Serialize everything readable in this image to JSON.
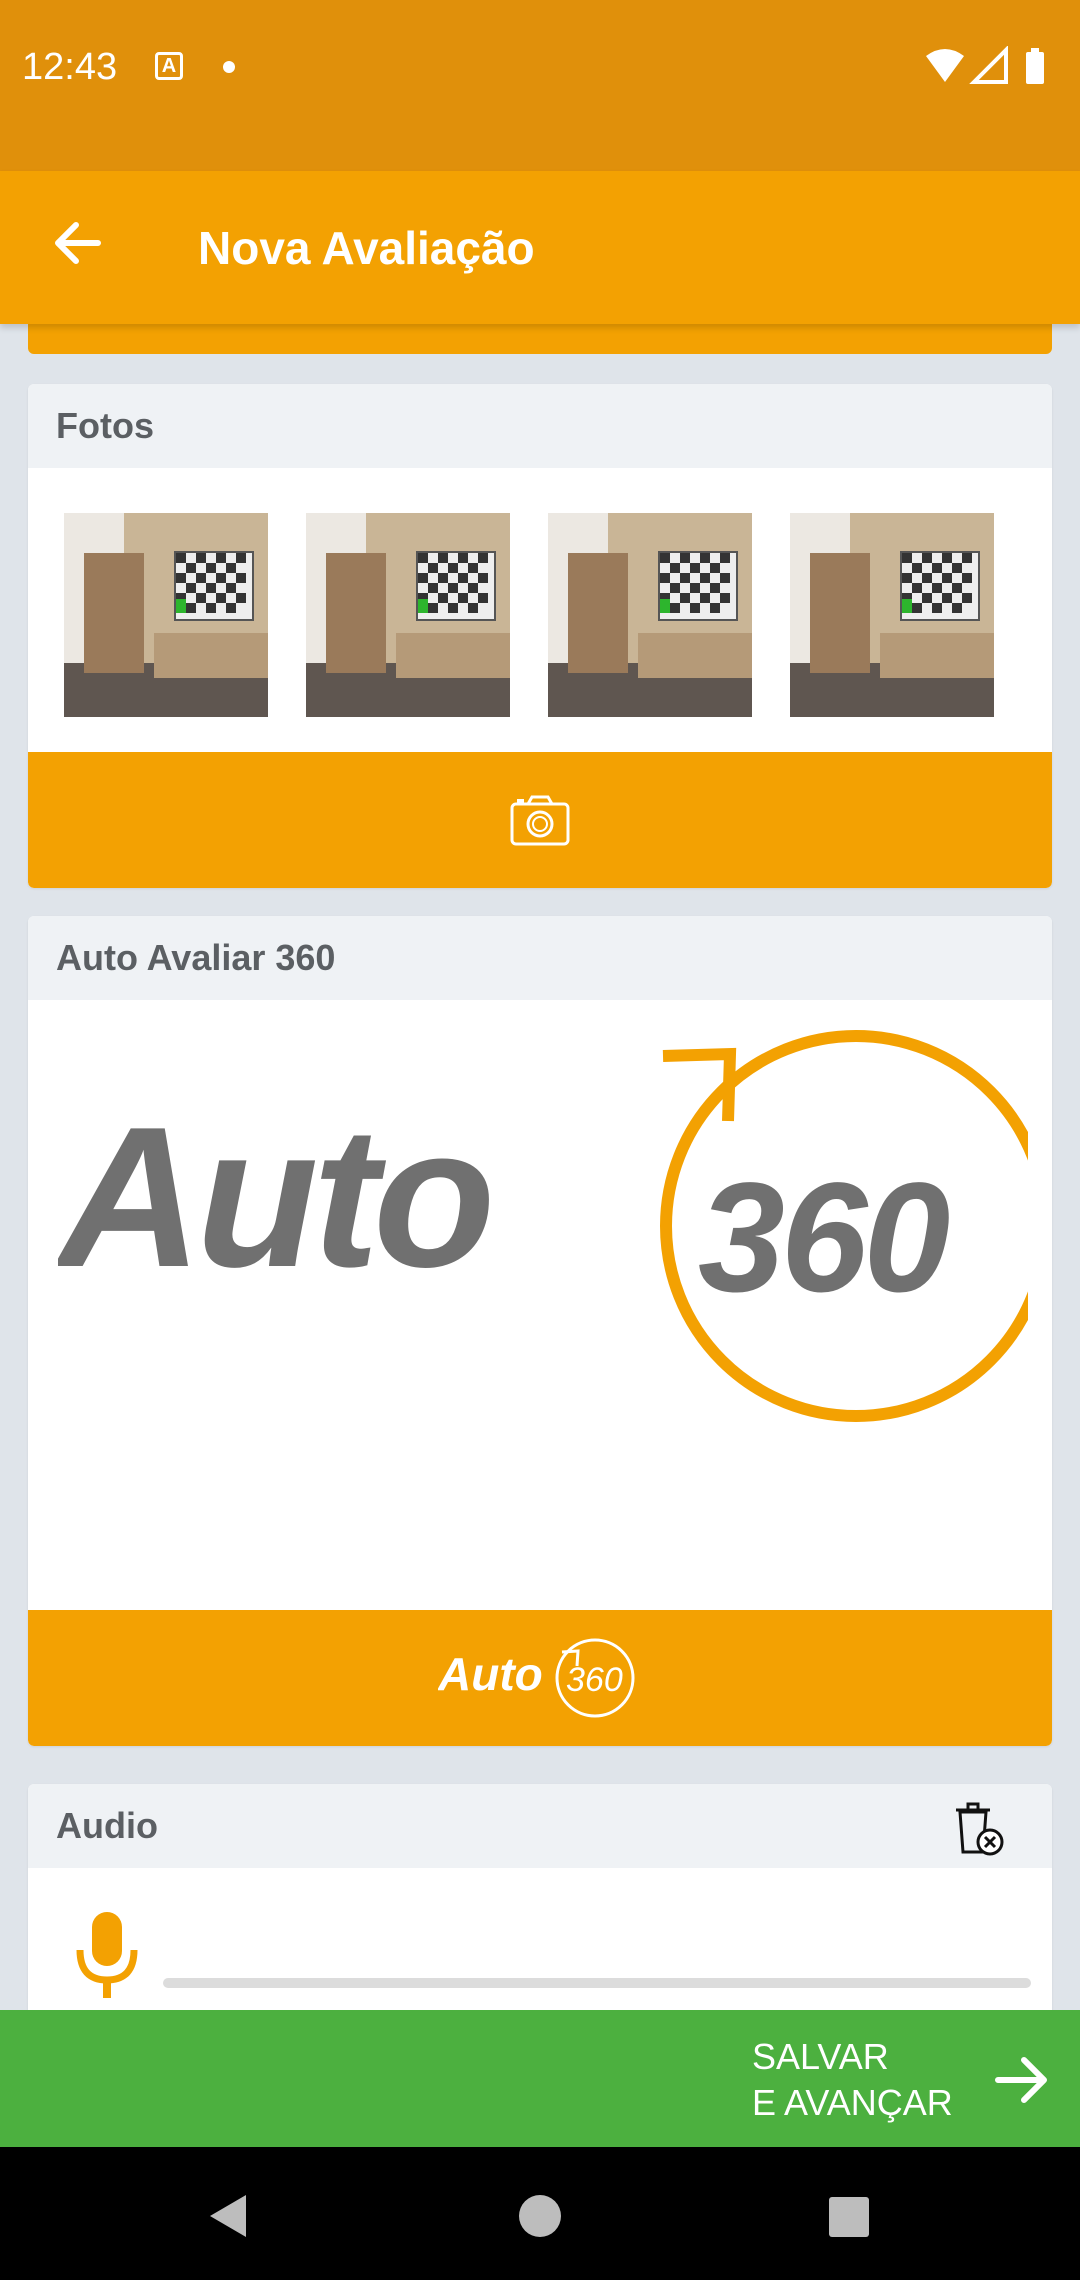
{
  "status": {
    "time": "12:43"
  },
  "app_bar": {
    "title": "Nova Avaliação"
  },
  "fotos": {
    "title": "Fotos",
    "thumbnails": [
      "room-photo",
      "room-photo",
      "room-photo",
      "room-photo"
    ]
  },
  "auto360": {
    "title": "Auto Avaliar 360",
    "logo_word": "Auto",
    "logo_number": "360"
  },
  "audio": {
    "title": "Audio"
  },
  "save_button": {
    "line1": "SALVAR",
    "line2": "E AVANÇAR"
  },
  "colors": {
    "status_bar": "#e0900b",
    "accent": "#f3a102",
    "save_green": "#4cb03f",
    "logo_gray": "#707070"
  }
}
